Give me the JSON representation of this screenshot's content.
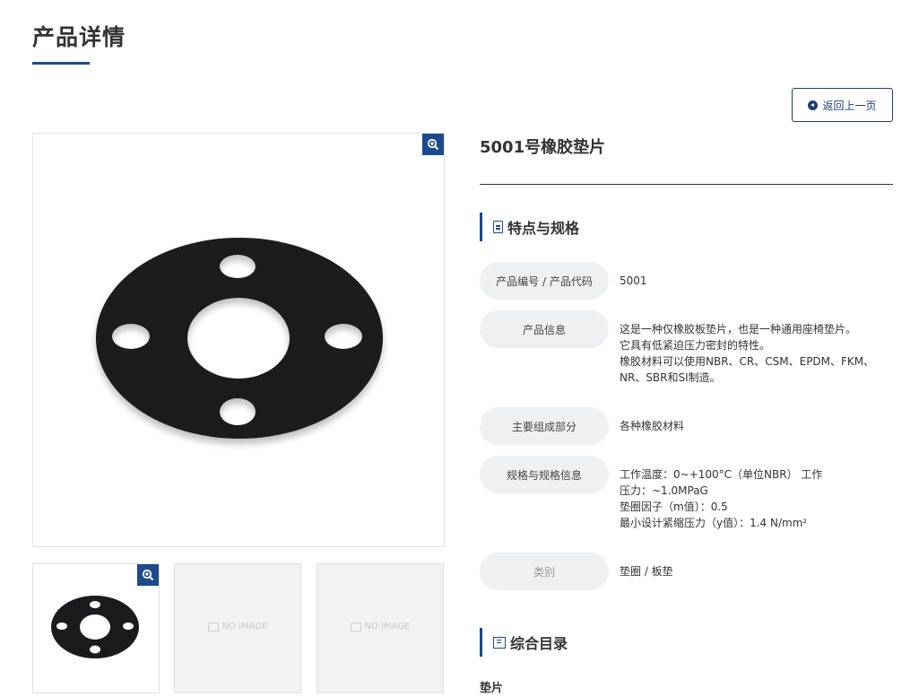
{
  "page": {
    "title": "产品详情"
  },
  "back_button": {
    "label": "返回上一页"
  },
  "gallery": {
    "placeholder_label": "NO IMAGE"
  },
  "product": {
    "name": "5001号橡胶垫片"
  },
  "specs_section": {
    "title": "特点与规格"
  },
  "specs": [
    {
      "label": "产品编号 / 产品代码",
      "lines": [
        "5001"
      ]
    },
    {
      "label": "产品信息",
      "lines": [
        "这是一种仅橡胶板垫片，也是一种通用座椅垫片。",
        "它具有低紧迫压力密封的特性。",
        "橡胶材料可以使用NBR、CR、CSM、EPDM、FKM、",
        "NR、SBR和SI制造。"
      ]
    },
    {
      "label": "主要组成部分",
      "lines": [
        "各种橡胶材料"
      ]
    },
    {
      "label": "规格与规格信息",
      "lines": [
        "工作温度：0~+100°C（单位NBR） 工作",
        "压力：~1.0MPaG",
        "垫圈因子（m值）：0.5",
        "最小设计紧缩压力（y值）：1.4 N/mm²"
      ]
    },
    {
      "label": "类别",
      "lines": [
        "垫圈 / 板垫"
      ]
    }
  ],
  "catalog_section": {
    "title": "综合目录",
    "items": [
      "垫片"
    ]
  },
  "colors": {
    "accent": "#1c4a8c",
    "label_bg": "#eef0f2"
  },
  "icons": {
    "back": "arrow-circle-left-icon",
    "zoom": "zoom-in-icon",
    "document": "document-icon",
    "catalog": "book-icon",
    "placeholder": "image-placeholder-icon"
  }
}
